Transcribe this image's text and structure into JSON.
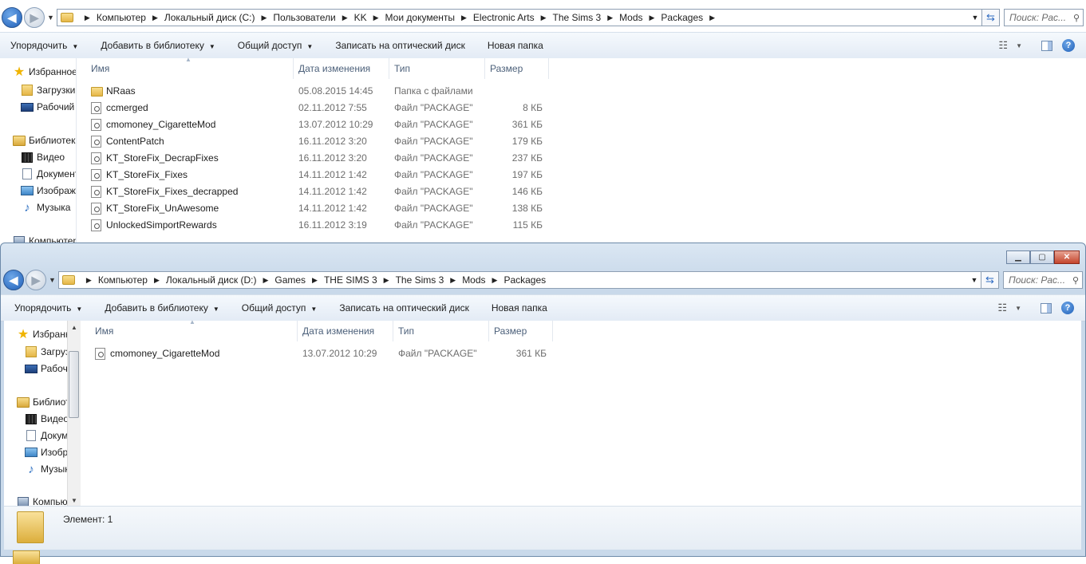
{
  "window1": {
    "breadcrumbs": [
      "Компьютер",
      "Локальный диск (C:)",
      "Пользователи",
      "KK",
      "Мои документы",
      "Electronic Arts",
      "The Sims 3",
      "Mods",
      "Packages"
    ],
    "search_placeholder": "Поиск: Рас...",
    "toolbar": {
      "organize": "Упорядочить",
      "add_to_library": "Добавить в библиотеку",
      "share": "Общий доступ",
      "burn": "Записать на оптический диск",
      "new_folder": "Новая папка"
    },
    "nav": {
      "favorites": "Избранное",
      "downloads": "Загрузки",
      "desktop": "Рабочий",
      "libraries": "Библиотеки",
      "video": "Видео",
      "documents": "Документы",
      "images": "Изображения",
      "music": "Музыка",
      "computer": "Компьютер"
    },
    "columns": {
      "name": "Имя",
      "date": "Дата изменения",
      "type": "Тип",
      "size": "Размер"
    },
    "files": [
      {
        "name": "NRaas",
        "date": "05.08.2015 14:45",
        "type": "Папка с файлами",
        "size": ""
      },
      {
        "name": "ccmerged",
        "date": "02.11.2012 7:55",
        "type": "Файл \"PACKAGE\"",
        "size": "8 КБ"
      },
      {
        "name": "cmomoney_CigaretteMod",
        "date": "13.07.2012 10:29",
        "type": "Файл \"PACKAGE\"",
        "size": "361 КБ"
      },
      {
        "name": "ContentPatch",
        "date": "16.11.2012 3:20",
        "type": "Файл \"PACKAGE\"",
        "size": "179 КБ"
      },
      {
        "name": "KT_StoreFix_DecrapFixes",
        "date": "16.11.2012 3:20",
        "type": "Файл \"PACKAGE\"",
        "size": "237 КБ"
      },
      {
        "name": "KT_StoreFix_Fixes",
        "date": "14.11.2012 1:42",
        "type": "Файл \"PACKAGE\"",
        "size": "197 КБ"
      },
      {
        "name": "KT_StoreFix_Fixes_decrapped",
        "date": "14.11.2012 1:42",
        "type": "Файл \"PACKAGE\"",
        "size": "146 КБ"
      },
      {
        "name": "KT_StoreFix_UnAwesome",
        "date": "14.11.2012 1:42",
        "type": "Файл \"PACKAGE\"",
        "size": "138 КБ"
      },
      {
        "name": "UnlockedSimportRewards",
        "date": "16.11.2012 3:19",
        "type": "Файл \"PACKAGE\"",
        "size": "115 КБ"
      }
    ]
  },
  "window2": {
    "breadcrumbs": [
      "Компьютер",
      "Локальный диск (D:)",
      "Games",
      "THE SIMS 3",
      "The Sims 3",
      "Mods",
      "Packages"
    ],
    "search_placeholder": "Поиск: Рас...",
    "toolbar": {
      "organize": "Упорядочить",
      "add_to_library": "Добавить в библиотеку",
      "share": "Общий доступ",
      "burn": "Записать на оптический диск",
      "new_folder": "Новая папка"
    },
    "nav": {
      "favorites": "Избранное",
      "downloads": "Загрузки",
      "desktop": "Рабочий",
      "libraries": "Библиотеки",
      "video": "Видео",
      "documents": "Документы",
      "images": "Изображения",
      "music": "Музыка",
      "computer": "Компьютер"
    },
    "columns": {
      "name": "Имя",
      "date": "Дата изменения",
      "type": "Тип",
      "size": "Размер"
    },
    "files": [
      {
        "name": "cmomoney_CigaretteMod",
        "date": "13.07.2012 10:29",
        "type": "Файл \"PACKAGE\"",
        "size": "361 КБ"
      }
    ],
    "status": "Элемент: 1"
  }
}
